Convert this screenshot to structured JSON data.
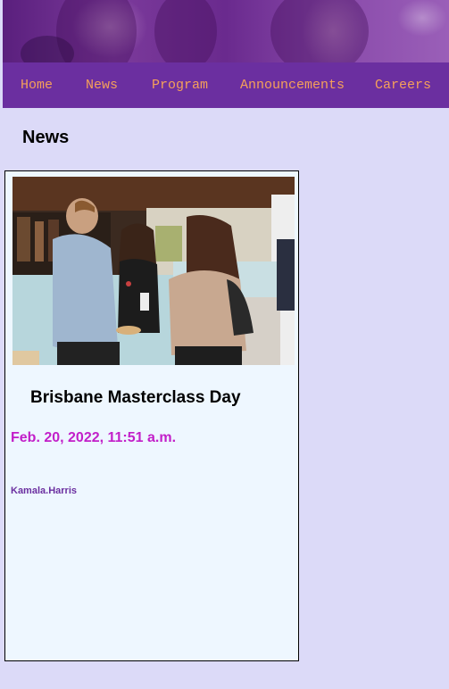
{
  "header": {
    "banner_image": "hero-banner-photo"
  },
  "nav": {
    "items": [
      {
        "label": "Home"
      },
      {
        "label": "News"
      },
      {
        "label": "Program"
      },
      {
        "label": "Announcements"
      },
      {
        "label": "Careers"
      }
    ]
  },
  "main": {
    "title": "News",
    "articles": [
      {
        "image": "event-photo",
        "title": "Brisbane Masterclass Day",
        "date": "Feb. 20, 2022, 11:51 a.m.",
        "author": "Kamala.Harris"
      }
    ]
  },
  "colors": {
    "page_bg": "#dcdaf8",
    "nav_bg": "#6b2fa0",
    "nav_text": "#f5a05a",
    "card_bg": "#eef7ff",
    "date_text": "#c21fc9",
    "author_text": "#6b2fa0"
  }
}
